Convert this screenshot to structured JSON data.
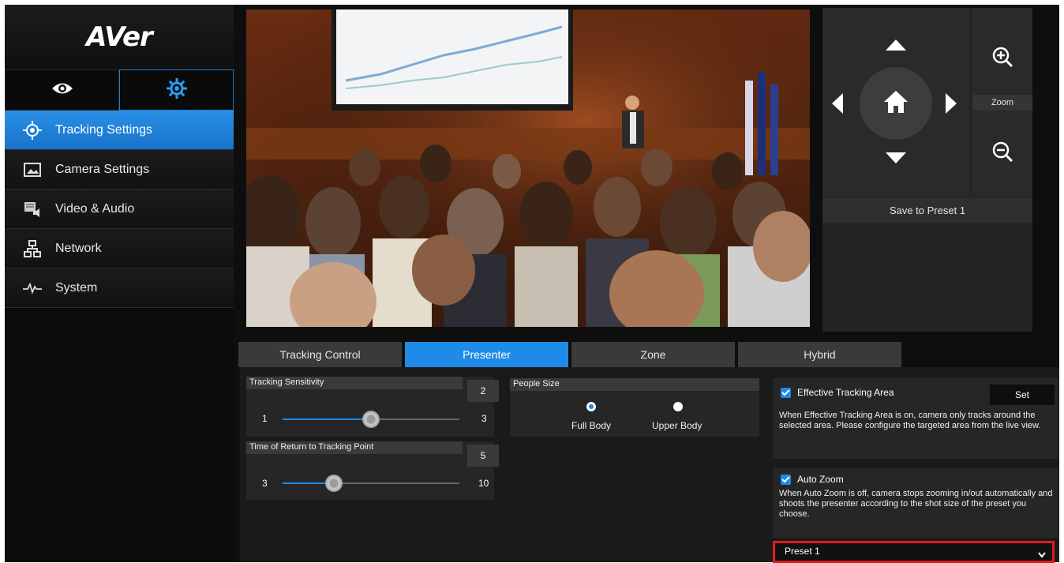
{
  "brand": {
    "logo_text": "AVer"
  },
  "sidebar": {
    "mode_tabs": [
      {
        "icon": "eye-icon"
      },
      {
        "icon": "gear-icon"
      }
    ],
    "items": [
      {
        "label": "Tracking Settings",
        "icon": "crosshair-icon",
        "active": true
      },
      {
        "label": "Camera Settings",
        "icon": "image-icon",
        "active": false
      },
      {
        "label": "Video & Audio",
        "icon": "video-audio-icon",
        "active": false
      },
      {
        "label": "Network",
        "icon": "network-icon",
        "active": false
      },
      {
        "label": "System",
        "icon": "pulse-icon",
        "active": false
      }
    ]
  },
  "camera_control": {
    "zoom_label": "Zoom",
    "save_preset_label": "Save to Preset 1"
  },
  "tabs": [
    {
      "label": "Tracking Control",
      "active": false
    },
    {
      "label": "Presenter",
      "active": true
    },
    {
      "label": "Zone",
      "active": false
    },
    {
      "label": "Hybrid",
      "active": false
    }
  ],
  "presenter": {
    "tracking_sensitivity": {
      "title": "Tracking Sensitivity",
      "value": "2",
      "min": "1",
      "max": "3",
      "level": 0.5
    },
    "return_time": {
      "title": "Time of Return to Tracking Point",
      "value": "5",
      "min": "3",
      "max": "10",
      "level": 0.29
    },
    "people_size": {
      "title": "People Size",
      "options": [
        {
          "label": "Full Body",
          "selected": true
        },
        {
          "label": "Upper Body",
          "selected": false
        }
      ]
    },
    "effective_tracking_area": {
      "label": "Effective Tracking Area",
      "checked": true,
      "set_button": "Set",
      "description": "When Effective Tracking Area is on, camera only tracks around the selected area. Please configure the targeted area from the live view."
    },
    "auto_zoom": {
      "label": "Auto Zoom",
      "checked": true,
      "description": "When Auto Zoom is off, camera stops zooming in/out automatically and shoots the presenter according to the shot size of the preset you choose."
    },
    "preset_select": {
      "value": "Preset 1"
    }
  },
  "colors": {
    "accent": "#1e8be8",
    "highlight": "#e21b1b"
  }
}
